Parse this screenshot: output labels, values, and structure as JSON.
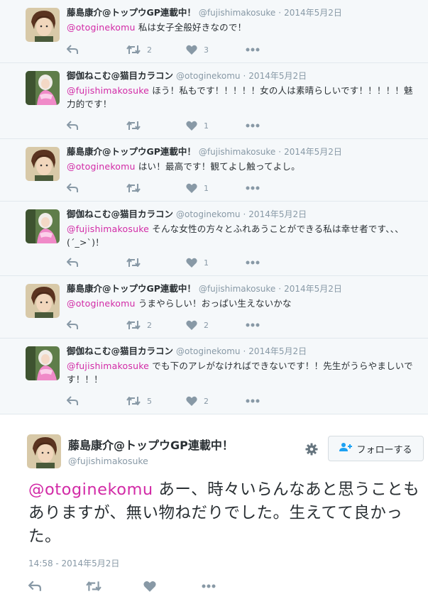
{
  "colors": {
    "mention": "#d22aa6",
    "meta": "#8899a6",
    "divider": "#e1e8ed"
  },
  "replies": [
    {
      "name": "藤島康介@トップウGP連載中！",
      "handle": "@fujishimakosuke",
      "dot": "·",
      "time": "2014年5月2日",
      "mention": "@otoginekomu",
      "text": " 私は女子全般好きなので！",
      "retweets": "2",
      "likes": "3",
      "avatar": "boy"
    },
    {
      "name": "御伽ねこむ@猫目カラコン",
      "handle": "@otoginekomu",
      "dot": "·",
      "time": "2014年5月2日",
      "mention": "@fujishimakosuke",
      "text": " ほう！私もです！！！！！女の人は素晴らしいです！！！！！魅力的です！",
      "retweets": "",
      "likes": "1",
      "avatar": "girl"
    },
    {
      "name": "藤島康介@トップウGP連載中！",
      "handle": "@fujishimakosuke",
      "dot": "·",
      "time": "2014年5月2日",
      "mention": "@otoginekomu",
      "text": " はい！最高です！観てよし触ってよし。",
      "retweets": "",
      "likes": "1",
      "avatar": "boy"
    },
    {
      "name": "御伽ねこむ@猫目カラコン",
      "handle": "@otoginekomu",
      "dot": "·",
      "time": "2014年5月2日",
      "mention": "@fujishimakosuke",
      "text": " そんな女性の方々とふれあうことができる私は幸せ者です、、、(´_>`)！",
      "retweets": "",
      "likes": "1",
      "avatar": "girl"
    },
    {
      "name": "藤島康介@トップウGP連載中！",
      "handle": "@fujishimakosuke",
      "dot": "·",
      "time": "2014年5月2日",
      "mention": "@otoginekomu",
      "text": " うまやらしい！おっぱい生えないかな",
      "retweets": "2",
      "likes": "2",
      "avatar": "boy"
    },
    {
      "name": "御伽ねこむ@猫目カラコン",
      "handle": "@otoginekomu",
      "dot": "·",
      "time": "2014年5月2日",
      "mention": "@fujishimakosuke",
      "text": " でも下のアレがなければできないです！！先生がうらやましいです！！！",
      "retweets": "5",
      "likes": "2",
      "avatar": "girl"
    }
  ],
  "main": {
    "name": "藤島康介@トップウGP連載中！",
    "handle": "@fujishimakosuke",
    "follow_label": "フォローする",
    "mention": "@otoginekomu",
    "text": " あー、時々いらんなあと思うこともありますが、無い物ねだりでした。生えてて良かった。",
    "timestamp": "14:58 - 2014年5月2日"
  },
  "icons": {
    "reply": "reply-icon",
    "retweet": "retweet-icon",
    "like": "heart-icon",
    "more": "more-icon",
    "gear": "gear-icon",
    "follow": "person-add-icon"
  }
}
